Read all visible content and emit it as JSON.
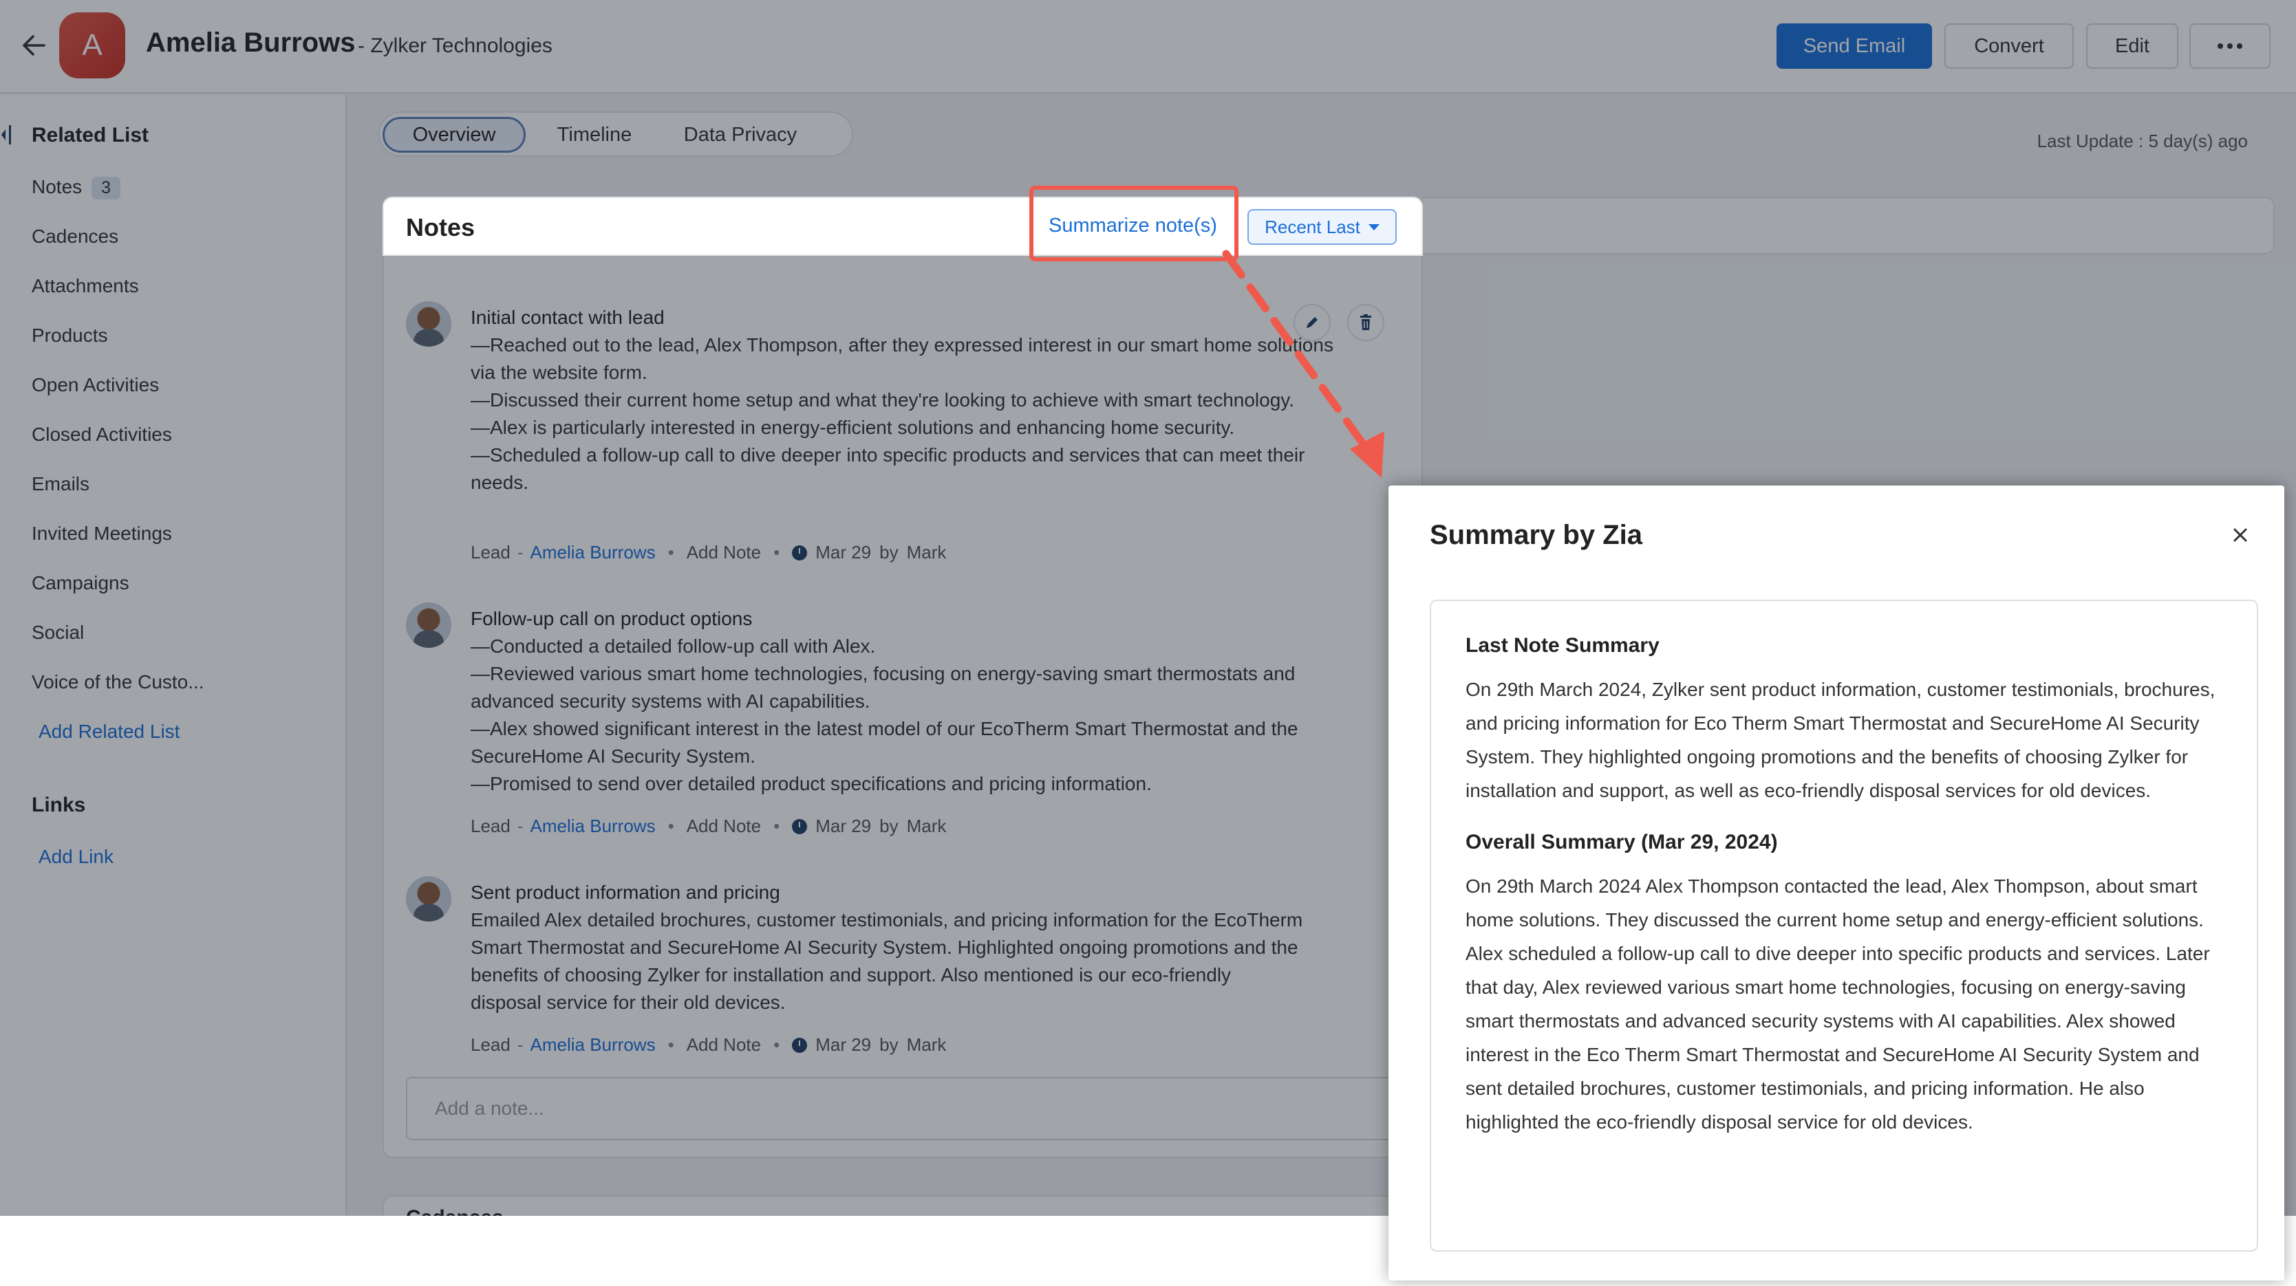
{
  "header": {
    "avatar_letter": "A",
    "name": "Amelia Burrows",
    "company": "- Zylker Technologies",
    "send_email": "Send Email",
    "convert": "Convert",
    "edit": "Edit"
  },
  "sidebar": {
    "related_heading": "Related List",
    "notes_count": "3",
    "items": [
      "Notes",
      "Cadences",
      "Attachments",
      "Products",
      "Open Activities",
      "Closed Activities",
      "Emails",
      "Invited Meetings",
      "Campaigns",
      "Social",
      "Voice of the Custo..."
    ],
    "add_related": "Add Related List",
    "links_heading": "Links",
    "add_link": "Add Link"
  },
  "tabs": [
    "Overview",
    "Timeline",
    "Data Privacy"
  ],
  "last_update": "Last Update : 5 day(s) ago",
  "notes": {
    "title": "Notes",
    "summarize": "Summarize note(s)",
    "sort": "Recent Last",
    "input_placeholder": "Add a note...",
    "items": [
      {
        "title": "Initial contact with lead",
        "lines": [
          "—Reached out to the lead, Alex Thompson, after they expressed interest in our smart home solutions via the website form.",
          "—Discussed their current home setup and what they're looking to achieve with smart technology.",
          "—Alex is particularly interested in energy-efficient solutions and enhancing home security.",
          "—Scheduled a follow-up call to dive deeper into specific products and services that can meet their needs."
        ],
        "meta_type": "Lead",
        "meta_sep": "-",
        "meta_name": "Amelia Burrows",
        "meta_add": "Add Note",
        "meta_date": "Mar 29",
        "meta_by": "by",
        "meta_author": "Mark"
      },
      {
        "title": "Follow-up call on product options",
        "lines": [
          "—Conducted a detailed follow-up call with Alex.",
          "—Reviewed various smart home technologies, focusing on energy-saving smart thermostats and advanced security systems with AI capabilities.",
          "—Alex showed significant interest in the latest model of our EcoTherm Smart Thermostat and the SecureHome AI Security System.",
          "—Promised to send over detailed product specifications and pricing information."
        ],
        "meta_type": "Lead",
        "meta_sep": "-",
        "meta_name": "Amelia Burrows",
        "meta_add": "Add Note",
        "meta_date": "Mar 29",
        "meta_by": "by",
        "meta_author": "Mark"
      },
      {
        "title": "Sent product information and pricing",
        "lines": [
          "Emailed Alex detailed brochures, customer testimonials, and pricing information for the EcoTherm Smart Thermostat and SecureHome AI Security System. Highlighted ongoing promotions and the benefits of choosing Zylker for installation and support. Also mentioned is our eco-friendly disposal service for their old devices."
        ],
        "meta_type": "Lead",
        "meta_sep": "-",
        "meta_name": "Amelia Burrows",
        "meta_add": "Add Note",
        "meta_date": "Mar 29",
        "meta_by": "by",
        "meta_author": "Mark"
      }
    ]
  },
  "cadences_peek": "Cadences",
  "summary": {
    "title": "Summary by Zia",
    "last_heading": "Last Note Summary",
    "last_text": "On 29th March 2024, Zylker sent product information, customer testimonials, brochures, and pricing information for Eco Therm Smart Thermostat and SecureHome AI Security System. They highlighted ongoing promotions and the benefits of choosing Zylker for installation and support, as well as eco-friendly disposal services for old devices.",
    "overall_heading": "Overall Summary (Mar 29, 2024)",
    "overall_text": "On 29th March 2024 Alex Thompson contacted the lead, Alex Thompson, about smart home solutions. They discussed the current home setup and energy-efficient solutions. Alex scheduled a follow-up call to dive deeper into specific products and services. Later that day, Alex reviewed various smart home technologies, focusing on energy-saving smart thermostats and advanced security systems with AI capabilities. Alex showed interest in the Eco Therm Smart Thermostat and SecureHome AI Security System and sent detailed brochures, customer testimonials, and pricing information. He also highlighted the eco-friendly disposal service for old devices."
  },
  "colors": {
    "accent": "#1a6fd8",
    "highlight": "#ef5a4c"
  }
}
